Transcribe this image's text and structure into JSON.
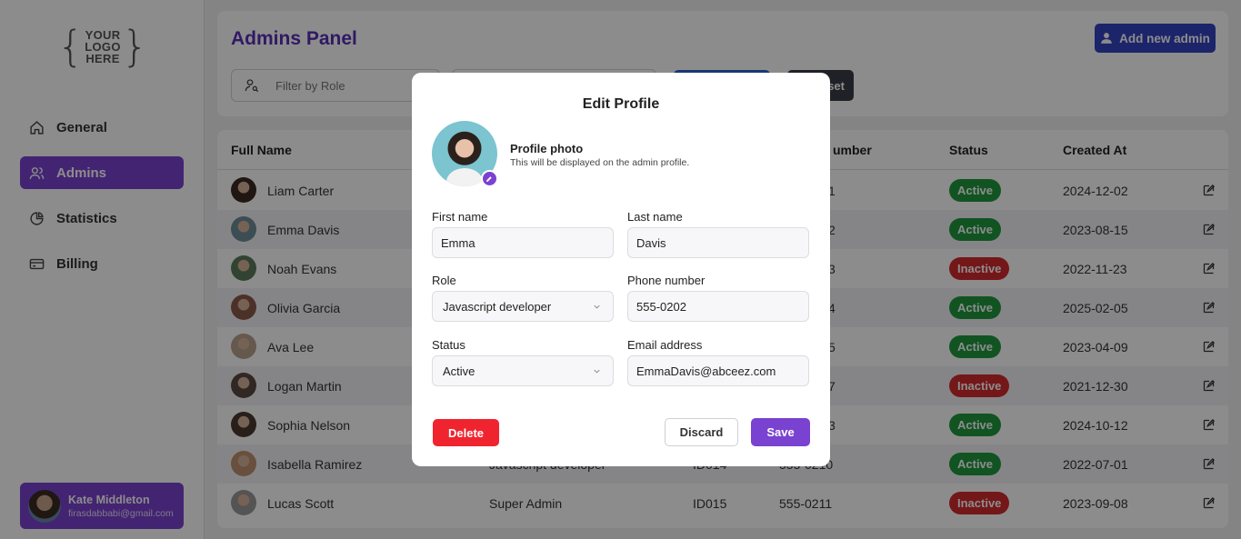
{
  "logo": {
    "line1": "YOUR",
    "line2": "LOGO",
    "line3": "HERE"
  },
  "sidebar": {
    "items": [
      {
        "label": "General",
        "icon": "home-icon"
      },
      {
        "label": "Admins",
        "icon": "users-icon",
        "active": true
      },
      {
        "label": "Statistics",
        "icon": "pie-chart-icon"
      },
      {
        "label": "Billing",
        "icon": "credit-card-icon"
      }
    ],
    "user": {
      "name": "Kate Middleton",
      "email": "firasdabbabi@gmail.com"
    }
  },
  "header": {
    "title": "Admins Panel",
    "add_button": "Add new admin",
    "filter_placeholder": "Filter by Role",
    "reset_label": "set"
  },
  "table": {
    "columns": [
      "Full Name",
      "umber",
      "Status",
      "Created At"
    ],
    "rows": [
      {
        "name": "Liam Carter",
        "num_fragment": "1",
        "status": "Active",
        "created": "2024-12-02"
      },
      {
        "name": "Emma Davis",
        "num_fragment": "2",
        "status": "Active",
        "created": "2023-08-15"
      },
      {
        "name": "Noah Evans",
        "num_fragment": "3",
        "status": "Inactive",
        "created": "2022-11-23"
      },
      {
        "name": "Olivia Garcia",
        "num_fragment": "4",
        "status": "Active",
        "created": "2025-02-05"
      },
      {
        "name": "Ava Lee",
        "num_fragment": "5",
        "status": "Active",
        "created": "2023-04-09"
      },
      {
        "name": "Logan Martin",
        "num_fragment": "7",
        "status": "Inactive",
        "created": "2021-12-30"
      },
      {
        "name": "Sophia Nelson",
        "num_fragment": "3",
        "status": "Active",
        "created": "2024-10-12"
      },
      {
        "name": "Isabella Ramirez",
        "role": "Javascript developer",
        "id": "ID014",
        "num_fragment": "555-0210",
        "status": "Active",
        "created": "2022-07-01"
      },
      {
        "name": "Lucas Scott",
        "role": "Super Admin",
        "id": "ID015",
        "num_fragment": "555-0211",
        "status": "Inactive",
        "created": "2023-09-08"
      }
    ]
  },
  "modal": {
    "title": "Edit Profile",
    "photo_label": "Profile photo",
    "photo_sub": "This will be displayed on the admin profile.",
    "first_name_label": "First name",
    "first_name": "Emma",
    "last_name_label": "Last name",
    "last_name": "Davis",
    "role_label": "Role",
    "role": "Javascript developer",
    "phone_label": "Phone number",
    "phone": "555-0202",
    "status_label": "Status",
    "status": "Active",
    "email_label": "Email address",
    "email": "EmmaDavis@abceez.com",
    "delete": "Delete",
    "discard": "Discard",
    "save": "Save"
  },
  "colors": {
    "accent": "#7a42d0",
    "title": "#5a2fb8",
    "active": "#1f9a3f",
    "inactive": "#d42a2f",
    "delete": "#f0242f"
  }
}
